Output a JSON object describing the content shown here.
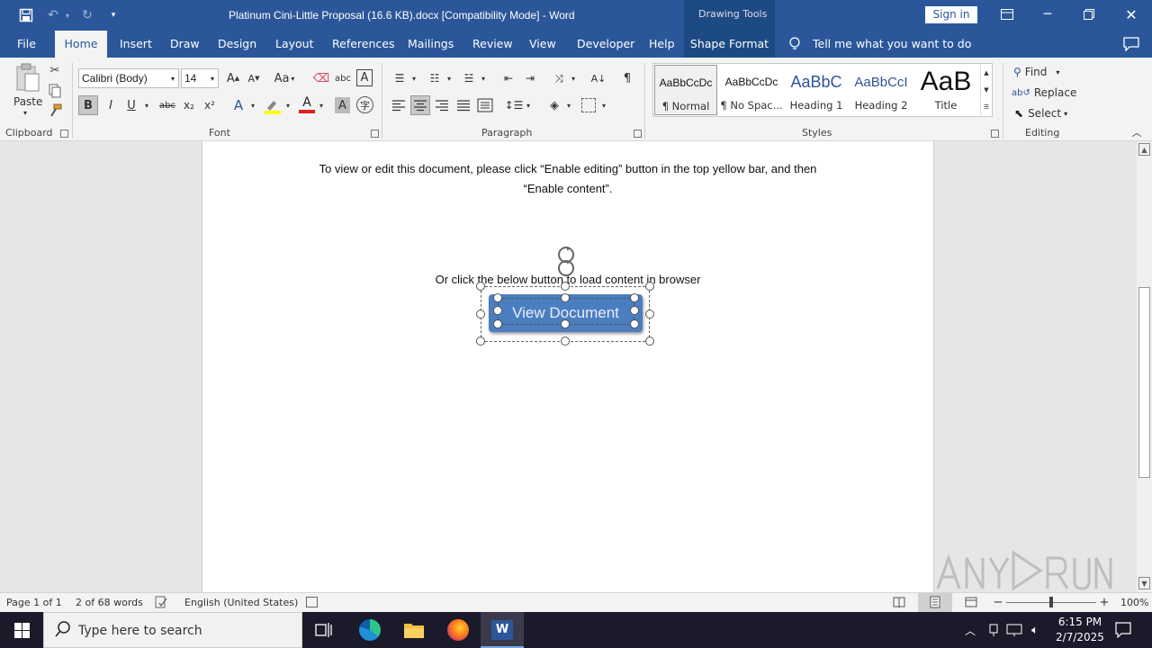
{
  "titlebar": {
    "title": "Platinum Cini-Little Proposal (16.6 KB).docx  [Compatibility Mode]  -  Word",
    "drawing_tools": "Drawing Tools",
    "sign_in": "Sign in"
  },
  "tabs": [
    "File",
    "Home",
    "Insert",
    "Draw",
    "Design",
    "Layout",
    "References",
    "Mailings",
    "Review",
    "View",
    "Developer",
    "Help",
    "Shape Format"
  ],
  "tell_me": "Tell me what you want to do",
  "ribbon": {
    "clipboard": {
      "paste": "Paste",
      "label": "Clipboard"
    },
    "font": {
      "name": "Calibri (Body)",
      "size": "14",
      "label": "Font",
      "change_case": "Aa",
      "bold": "B",
      "italic": "I",
      "underline": "U",
      "strike": "abc",
      "sub": "x₂",
      "sup": "x²"
    },
    "paragraph": {
      "label": "Paragraph",
      "pilcrow": "¶"
    },
    "styles": {
      "label": "Styles",
      "items": [
        {
          "preview": "AaBbCcDc",
          "name": "¶ Normal"
        },
        {
          "preview": "AaBbCcDc",
          "name": "¶ No Spac..."
        },
        {
          "preview": "AaBbC",
          "name": "Heading 1"
        },
        {
          "preview": "AaBbCcI",
          "name": "Heading 2"
        },
        {
          "preview": "AaB",
          "name": "Title"
        }
      ]
    },
    "editing": {
      "find": "Find",
      "replace": "Replace",
      "select": "Select",
      "label": "Editing"
    }
  },
  "document": {
    "line1": "To view or edit this document, please click “Enable editing” button in the top yellow bar, and then",
    "line2": "“Enable content”.",
    "line3": "Or click the below button to load content in browser",
    "button": "View Document"
  },
  "status": {
    "page": "Page 1 of 1",
    "words": "2 of 68 words",
    "language": "English (United States)",
    "zoom": "100%"
  },
  "taskbar": {
    "search_placeholder": "Type here to search",
    "time": "6:15 PM",
    "date": "2/7/2025"
  },
  "colors": {
    "word_blue": "#2b579a",
    "button_blue": "#4a7ec0"
  }
}
